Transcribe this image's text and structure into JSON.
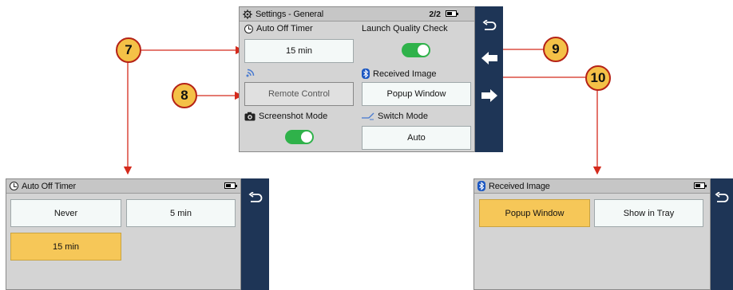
{
  "main_screen": {
    "title": "Settings - General",
    "page_indicator": "2/2",
    "auto_off": {
      "label": "Auto Off Timer",
      "value": "15 min"
    },
    "launch_quality_check": {
      "label": "Launch Quality Check",
      "on": true
    },
    "remote_control": {
      "label": "Remote Control",
      "enabled": false
    },
    "received_image": {
      "label": "Received Image",
      "value": "Popup Window"
    },
    "screenshot_mode": {
      "label": "Screenshot Mode",
      "on": true
    },
    "switch_mode": {
      "label": "Switch Mode",
      "value": "Auto"
    }
  },
  "auto_off_screen": {
    "title": "Auto Off Timer",
    "options": [
      "Never",
      "5 min",
      "15 min"
    ],
    "selected": "15 min"
  },
  "received_image_screen": {
    "title": "Received Image",
    "options": [
      "Popup Window",
      "Show in Tray"
    ],
    "selected": "Popup Window"
  },
  "callouts": [
    "7",
    "8",
    "9",
    "10"
  ],
  "colors": {
    "accent_green": "#2fb24a",
    "selected_yellow": "#f6c758",
    "nav_blue": "#1e3556",
    "arrow_red": "#d42a1c",
    "callout_fill": "#f4c147"
  },
  "icons": [
    "gear-icon",
    "battery-icon",
    "back-icon",
    "arrow-left-icon",
    "arrow-right-icon",
    "clock-icon",
    "wifi-icon",
    "bluetooth-icon",
    "camera-icon",
    "switch-mode-icon"
  ]
}
